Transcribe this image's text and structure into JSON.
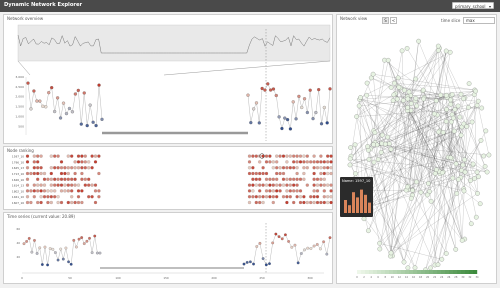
{
  "app": {
    "title": "Dynamic Network Explorer",
    "dataset": "primary_school"
  },
  "panels": {
    "overview": {
      "title": "Network overview"
    },
    "ranking": {
      "title": "Node ranking"
    },
    "timeseries": {
      "title": "Time series (current value: 20.89)"
    },
    "network": {
      "title": "Network view",
      "s_label": "S",
      "prev_label": "<",
      "time_slice_label": "time slice",
      "time_slice_value": "max"
    }
  },
  "tooltip": {
    "title": "Name: 1597_10"
  },
  "colors": {
    "accent": "#4a4a4a",
    "node_high": "#c0392b",
    "node_low": "#2c4a8c",
    "link": "#555555",
    "legend_low": "#eef7ea",
    "legend_high": "#3d8b3d"
  },
  "chart_data": [
    {
      "type": "line",
      "name": "main-scatter",
      "ylabel": "",
      "y_ticks": [
        "3,000",
        "2,500",
        "2,000",
        "1,500",
        "1,000",
        "500"
      ],
      "ylim": [
        0,
        3000
      ]
    },
    {
      "type": "heatmap",
      "name": "ranking",
      "row_labels": [
        "1597_10",
        "1796_10",
        "1625_13",
        "1713_16",
        "1626_16",
        "1614_13",
        "1802_10",
        "1461_10",
        "1607_16"
      ]
    },
    {
      "type": "line",
      "name": "time-series",
      "x_ticks": [
        "0",
        "50",
        "100",
        "150",
        "200",
        "250",
        "300"
      ],
      "y_ticks": [
        "60",
        "40",
        "20"
      ],
      "ylim": [
        0,
        60
      ]
    }
  ],
  "legend": {
    "ticks": [
      "0",
      "2",
      "4",
      "6",
      "8",
      "10",
      "12",
      "14",
      "16",
      "18",
      "20",
      "22",
      "24",
      "26",
      "28",
      "30",
      "32",
      "34"
    ]
  }
}
